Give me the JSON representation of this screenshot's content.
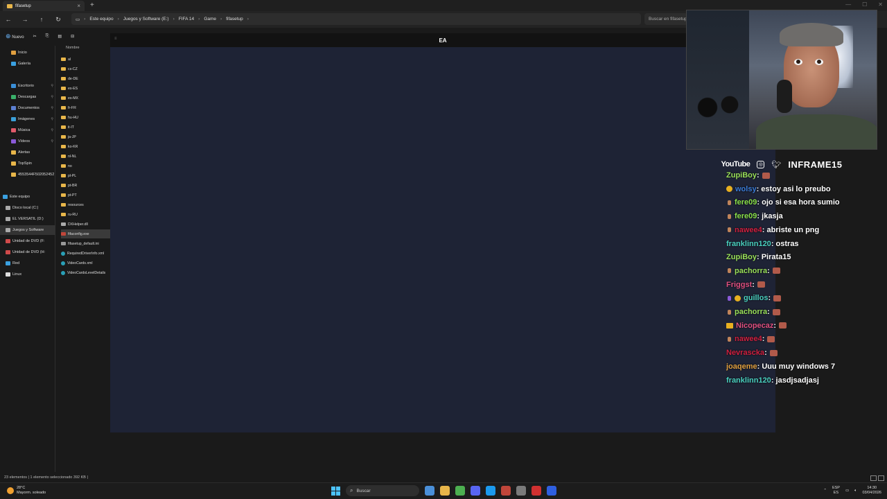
{
  "window": {
    "tab_title": "fifasetup",
    "close_glyph": "×",
    "new_tab_glyph": "+",
    "controls": [
      "—",
      "☐",
      "✕"
    ]
  },
  "navigation": {
    "breadcrumb": [
      "Este equipo",
      "Juegos y Software (E:)",
      "FIFA 14",
      "Game",
      "fifasetup"
    ],
    "search_placeholder": "Buscar en fifasetup"
  },
  "toolbar": {
    "new_label": "Nuevo"
  },
  "sidebar": {
    "items": [
      {
        "label": "Inicio",
        "icon": "home-icon",
        "color": "#e0a040"
      },
      {
        "label": "Galería",
        "icon": "gallery-icon",
        "color": "#3aa0e0"
      },
      {
        "label": "Escritorio",
        "icon": "desktop-icon",
        "color": "#3a8fd8",
        "pinned": true
      },
      {
        "label": "Descargas",
        "icon": "download-icon",
        "color": "#3ab06a",
        "pinned": true
      },
      {
        "label": "Documentos",
        "icon": "documents-icon",
        "color": "#5b7fd0",
        "pinned": true
      },
      {
        "label": "Imágenes",
        "icon": "images-icon",
        "color": "#3a9fd8",
        "pinned": true
      },
      {
        "label": "Música",
        "icon": "music-icon",
        "color": "#e05a6a",
        "pinned": true
      },
      {
        "label": "Vídeos",
        "icon": "videos-icon",
        "color": "#8a5ad8",
        "pinned": true
      },
      {
        "label": "Alertas",
        "icon": "folder-icon",
        "color": "#e8b64a"
      },
      {
        "label": "TopSpin",
        "icon": "folder-icon",
        "color": "#e8b64a"
      },
      {
        "label": "4553544F502052452",
        "icon": "folder-icon",
        "color": "#e8b64a"
      },
      {
        "label": "Este equipo",
        "icon": "pc-icon",
        "color": "#3aa0e0"
      },
      {
        "label": "Disco local (C:)",
        "icon": "drive-icon",
        "color": "#aaaaaa"
      },
      {
        "label": "EL VERSATIL (D:)",
        "icon": "drive-icon",
        "color": "#aaaaaa"
      },
      {
        "label": "Juegos y Software",
        "icon": "drive-icon",
        "color": "#aaaaaa"
      },
      {
        "label": "Unidad de DVD (F:",
        "icon": "dvd-icon",
        "color": "#d04a4a"
      },
      {
        "label": "Unidad de DVD (H:",
        "icon": "dvd-icon",
        "color": "#d04a4a"
      },
      {
        "label": "Red",
        "icon": "network-icon",
        "color": "#3aa0e0"
      },
      {
        "label": "Linux",
        "icon": "linux-icon",
        "color": "#dddddd"
      }
    ],
    "pin_glyph": "📌"
  },
  "files": {
    "column_header": "Nombre",
    "rows": [
      {
        "name": "al",
        "type": "folder"
      },
      {
        "name": "cs-CZ",
        "type": "folder"
      },
      {
        "name": "de-DE",
        "type": "folder"
      },
      {
        "name": "es-ES",
        "type": "folder"
      },
      {
        "name": "es-MX",
        "type": "folder"
      },
      {
        "name": "fr-FR",
        "type": "folder"
      },
      {
        "name": "hu-HU",
        "type": "folder"
      },
      {
        "name": "it-IT",
        "type": "folder"
      },
      {
        "name": "ja-JP",
        "type": "folder"
      },
      {
        "name": "ko-KR",
        "type": "folder"
      },
      {
        "name": "nl-NL",
        "type": "folder"
      },
      {
        "name": "no",
        "type": "folder"
      },
      {
        "name": "pl-PL",
        "type": "folder"
      },
      {
        "name": "pt-BR",
        "type": "folder"
      },
      {
        "name": "pt-PT",
        "type": "folder"
      },
      {
        "name": "resources",
        "type": "folder"
      },
      {
        "name": "ru-RU",
        "type": "folder"
      },
      {
        "name": "DXHelper.dll",
        "type": "dll"
      },
      {
        "name": "fifaconfig.exe",
        "type": "exe",
        "selected": true
      },
      {
        "name": "fifasetup_default.ini",
        "type": "ini"
      },
      {
        "name": "RequiredDriverInfo.xml",
        "type": "xml"
      },
      {
        "name": "VideoCards.xml",
        "type": "xml"
      },
      {
        "name": "VideoCardsLevelDetails",
        "type": "xml"
      }
    ]
  },
  "app": {
    "title": "EA",
    "menu_glyph": "≡"
  },
  "status": {
    "text": "23 elementos  |  1 elemento seleccionado  392 KB  |"
  },
  "stream": {
    "youtube": "YouTube",
    "brand": "INFRAME15",
    "chat": [
      {
        "user": "ZupiBoy",
        "color": "#9ae05a",
        "text": ": ",
        "emote": true,
        "badge": null
      },
      {
        "user": "wolsy",
        "color": "#3a7cd8",
        "text": ": estoy asi lo preubo",
        "badge": "#e8b020"
      },
      {
        "user": "fere09",
        "color": "#8ae04a",
        "text": ": ojo si esa hora sumio",
        "badge": "small"
      },
      {
        "user": "fere09",
        "color": "#8ae04a",
        "text": ": jkasja",
        "badge": "small"
      },
      {
        "user": "nawee4",
        "color": "#d02040",
        "text": ": abriste un png",
        "badge": "small"
      },
      {
        "user": "franklinn120",
        "color": "#4ad0c0",
        "text": ": ostras",
        "badge": null
      },
      {
        "user": "ZupiBoy",
        "color": "#9ae05a",
        "text": ": Pirata15",
        "badge": null
      },
      {
        "user": "pachorra",
        "color": "#9ae05a",
        "text": ": ",
        "emote": true,
        "badge": "small"
      },
      {
        "user": "Friggst",
        "color": "#e05080",
        "text": ": ",
        "emote": true,
        "badge": null
      },
      {
        "user": "guillos",
        "color": "#4ad0c0",
        "text": ": ",
        "emote": true,
        "badge": "double"
      },
      {
        "user": "pachorra",
        "color": "#9ae05a",
        "text": ": ",
        "emote": true,
        "badge": "small"
      },
      {
        "user": "Nicopecaz",
        "color": "#e05080",
        "text": ": ",
        "emote": true,
        "badge": "crown"
      },
      {
        "user": "nawee4",
        "color": "#d02040",
        "text": ": ",
        "emote": true,
        "badge": "small"
      },
      {
        "user": "Nevrascka",
        "color": "#d02040",
        "text": ": ",
        "emote": true,
        "badge": null
      },
      {
        "user": "joaqeme",
        "color": "#e0a040",
        "text": ": Uuu muy windows 7",
        "badge": null
      },
      {
        "user": "franklinn120",
        "color": "#4ad0c0",
        "text": ": jasdjsadjasj",
        "badge": null
      }
    ]
  },
  "taskbar": {
    "weather_temp": "28°C",
    "weather_desc": "Mayorm. soleado",
    "search_label": "Buscar",
    "lang_top": "ESP",
    "lang_bottom": "ES",
    "time": "14:30",
    "date": "03/04/2026",
    "apps": [
      "#4a8fd8",
      "#e8b64a",
      "#4caf50",
      "#5865f2",
      "#1b9aee",
      "#c0463a",
      "#7a7a7a",
      "#d03030",
      "#2f5fe0"
    ]
  }
}
